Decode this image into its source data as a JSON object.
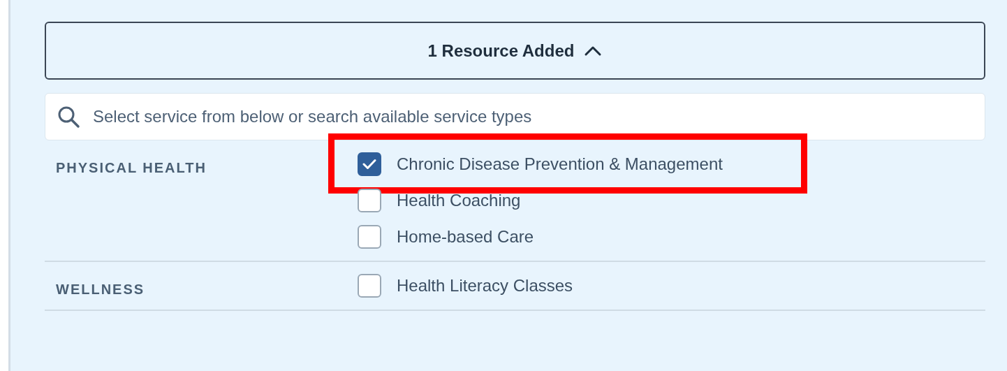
{
  "toggle": {
    "label": "1 Resource Added",
    "expanded": true
  },
  "search": {
    "placeholder": "Select service from below or search available service types"
  },
  "categories": [
    {
      "name": "PHYSICAL HEALTH",
      "options": [
        {
          "label": "Chronic Disease Prevention & Management",
          "checked": true,
          "highlighted": true
        },
        {
          "label": "Health Coaching",
          "checked": false,
          "highlighted": false
        },
        {
          "label": "Home-based Care",
          "checked": false,
          "highlighted": false
        }
      ]
    },
    {
      "name": "WELLNESS",
      "options": [
        {
          "label": "Health Literacy Classes",
          "checked": false,
          "highlighted": false
        }
      ]
    }
  ]
}
